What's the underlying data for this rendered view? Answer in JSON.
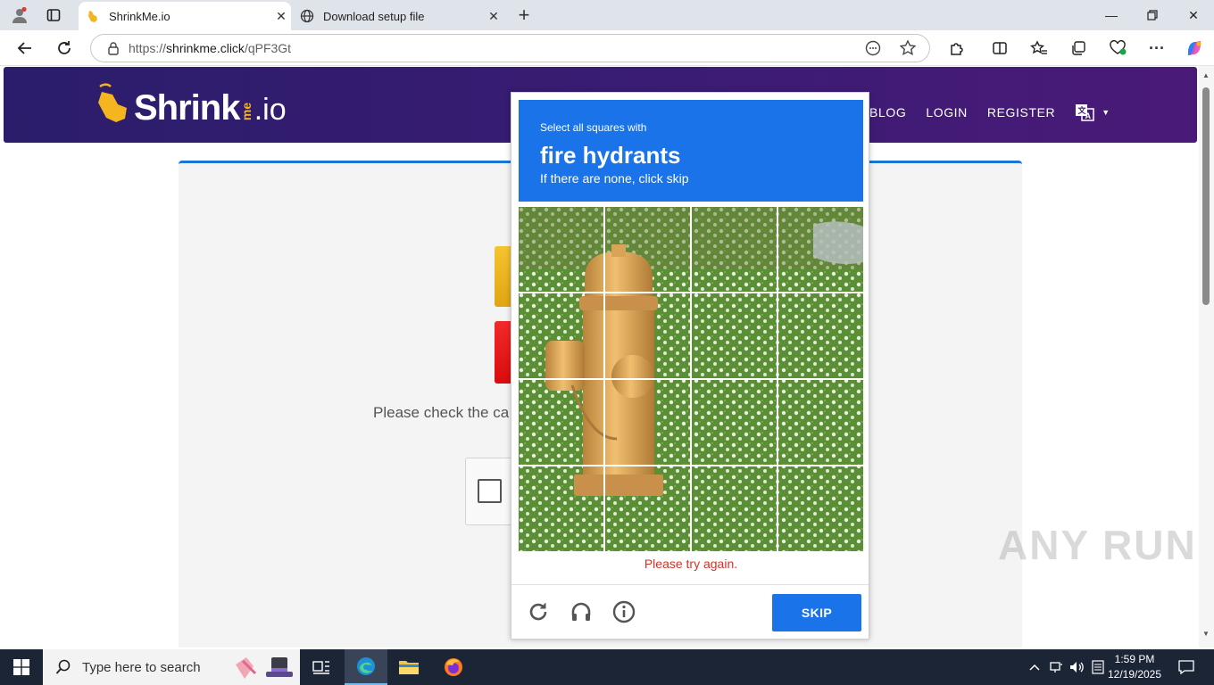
{
  "browser": {
    "tabs": [
      {
        "title": "ShrinkMe.io",
        "active": true
      },
      {
        "title": "Download setup file",
        "active": false
      }
    ],
    "url": {
      "prefix": "https://",
      "host": "shrinkme.click",
      "path": "/qPF3Gt"
    }
  },
  "site": {
    "logo": {
      "main": "Shrink",
      "sub": "me",
      "tld": ".io"
    },
    "nav": [
      "BLOG",
      "LOGIN",
      "REGISTER"
    ],
    "prompt_text": "Please check the ca"
  },
  "captcha": {
    "instruction_line1": "Select all squares with",
    "target": "fire hydrants",
    "instruction_line3": "If there are none, click skip",
    "error": "Please try again.",
    "skip_label": "SKIP",
    "grid": {
      "rows": 4,
      "cols": 4
    }
  },
  "watermark": "ANY RUN",
  "taskbar": {
    "search_placeholder": "Type here to search",
    "time": "1:59 PM",
    "date": "12/19/2025"
  },
  "colors": {
    "accent": "#1a73e8",
    "error": "#d93025",
    "header_purple": "#3a1c74",
    "card_border": "#1c77d2"
  }
}
